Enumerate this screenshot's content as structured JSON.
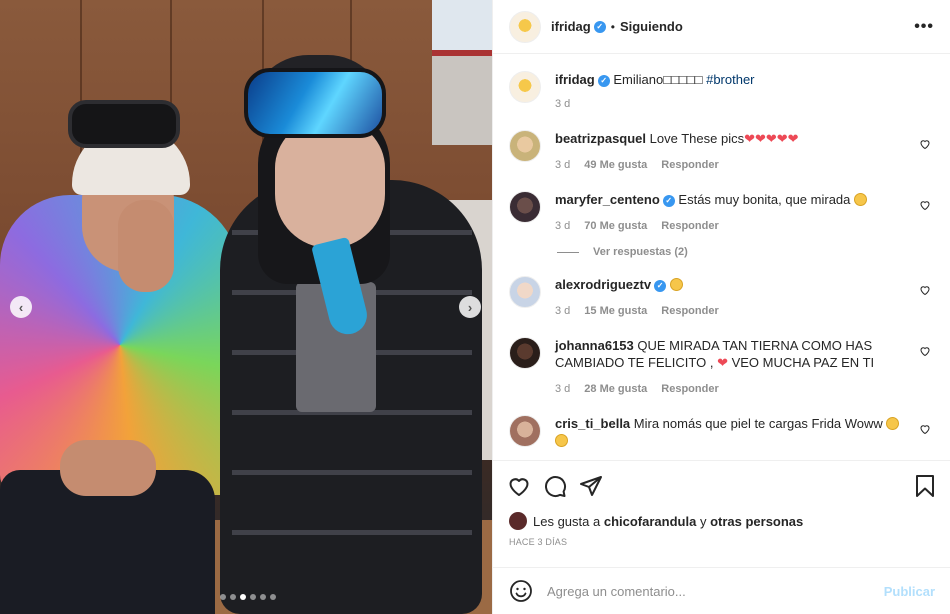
{
  "post": {
    "carousel": {
      "current_index": 3,
      "total": 6,
      "prev_icon": "chevron-left-icon",
      "next_icon": "chevron-right-icon"
    }
  },
  "header": {
    "username": "ifridag",
    "verified": true,
    "separator": "•",
    "follow_status": "Siguiendo",
    "more_icon": "more-options-icon",
    "more_label": "•••"
  },
  "caption": {
    "username": "ifridag",
    "text": "Emiliano□□□□□ ",
    "hashtag": "#brother",
    "time": "3 d"
  },
  "comments": [
    {
      "username": "beatrizpasquel",
      "verified": false,
      "text": "Love These pics",
      "hearts": 5,
      "time": "3 d",
      "likes": "49 Me gusta",
      "reply": "Responder"
    },
    {
      "username": "maryfer_centeno",
      "verified": true,
      "text": "Estás muy bonita, que mirada ",
      "emoji": "heart-eyes-emoji",
      "time": "3 d",
      "likes": "70 Me gusta",
      "reply": "Responder",
      "replies_label": "Ver respuestas (2)"
    },
    {
      "username": "alexrodrigueztv",
      "verified": true,
      "text": "",
      "emoji": "heart-eyes-emoji",
      "time": "3 d",
      "likes": "15 Me gusta",
      "reply": "Responder"
    },
    {
      "username": "johanna6153",
      "verified": false,
      "text": "QUE MIRADA TAN TIERNA COMO HAS CAMBIADO TE FELICITO ,",
      "text2": " VEO MUCHA PAZ EN TI",
      "time": "3 d",
      "likes": "28 Me gusta",
      "reply": "Responder"
    },
    {
      "username": "cris_ti_bella",
      "verified": false,
      "text": "Mira nomás que piel te cargas Frida Woww ",
      "emoji": "heart-eyes-emoji"
    }
  ],
  "actions": {
    "like_icon": "heart-icon",
    "comment_icon": "comment-icon",
    "share_icon": "share-icon",
    "save_icon": "bookmark-icon"
  },
  "likes": {
    "prefix": "Les gusta a",
    "user": "chicofarandula",
    "connector": "y",
    "others": "otras personas"
  },
  "timestamp": "HACE 3 DÍAS",
  "add_comment": {
    "emoji_icon": "emoji-icon",
    "placeholder": "Agrega un comentario...",
    "publish_label": "Publicar"
  },
  "colors": {
    "link_blue": "#00376b",
    "verified_blue": "#3897f0",
    "heart_red": "#ed4956",
    "muted_gray": "#8e8e8e",
    "publish_disabled": "#b2dffc"
  }
}
